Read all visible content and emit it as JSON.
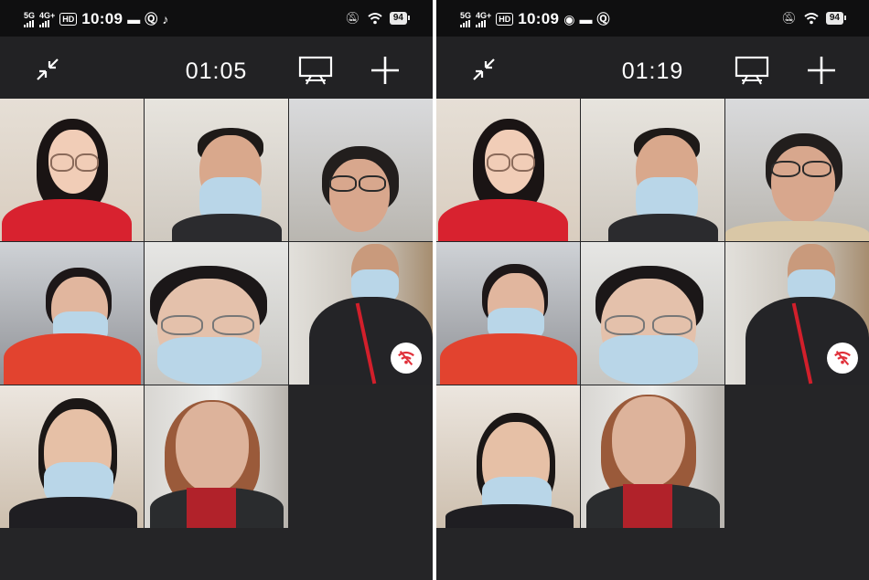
{
  "screens": [
    {
      "status_bar": {
        "network_1": "5G",
        "network_2": "4G+",
        "hd_label": "HD",
        "time": "10:09",
        "app_icons": [
          "message-icon",
          "q-icon",
          "tiktok-icon"
        ],
        "battery": "94"
      },
      "call_timer": "01:05",
      "toolbar_icons": [
        "collapse-icon",
        "screen-share-icon",
        "add-icon"
      ],
      "participants": 8
    },
    {
      "status_bar": {
        "network_1": "5G",
        "network_2": "4G+",
        "hd_label": "HD",
        "time": "10:09",
        "app_icons": [
          "wechat-icon",
          "message-icon",
          "q-icon"
        ],
        "battery": "94"
      },
      "call_timer": "01:19",
      "toolbar_icons": [
        "collapse-icon",
        "screen-share-icon",
        "add-icon"
      ],
      "participants": 8
    }
  ],
  "colors": {
    "background": "#252527",
    "status_bar": "#0f0f10",
    "toolbar": "#222224",
    "poor_network_badge": "#e0303a"
  }
}
